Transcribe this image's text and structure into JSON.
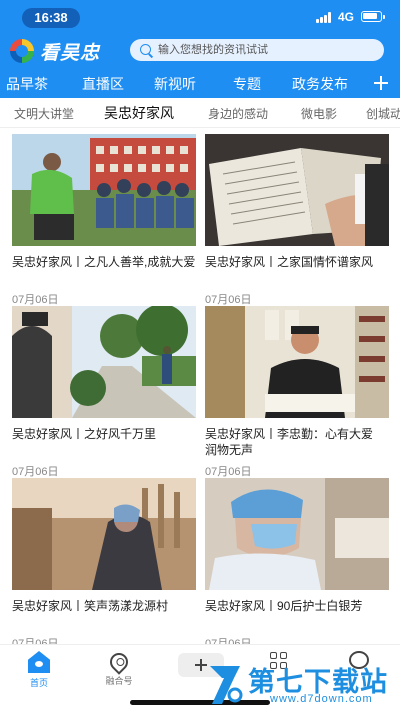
{
  "status": {
    "time": "16:38",
    "network": "4G"
  },
  "app": {
    "logo_text": "看吴忠"
  },
  "search": {
    "placeholder": "输入您想找的资讯试试"
  },
  "categories": [
    "品早茶",
    "直播区",
    "新视听",
    "专题",
    "政务发布"
  ],
  "subtabs": [
    "文明大讲堂",
    "吴忠好家风",
    "身边的感动",
    "微电影",
    "创城动"
  ],
  "active_subtab": "吴忠好家风",
  "articles": [
    {
      "title": "吴忠好家风丨之凡人善举,成就大爱",
      "date": "07月06日"
    },
    {
      "title": "吴忠好家风丨之家国情怀谱家风",
      "date": "07月06日"
    },
    {
      "title": "吴忠好家风丨之好风千万里",
      "date": "07月06日"
    },
    {
      "title": "吴忠好家风丨李忠勤：心有大爱　润物无声",
      "date": "07月06日"
    },
    {
      "title": "吴忠好家风丨笑声荡漾龙源村",
      "date": "07月06日"
    },
    {
      "title": "吴忠好家风丨90后护士白银芳",
      "date": "07月06日"
    }
  ],
  "bottom_nav": {
    "home": "首页",
    "fusion": "融合号"
  },
  "watermark": {
    "text": "第七下载站",
    "url": "www.d7down.com"
  },
  "colors": {
    "brand": "#1f8ef2",
    "watermark": "#1e8fe0"
  }
}
